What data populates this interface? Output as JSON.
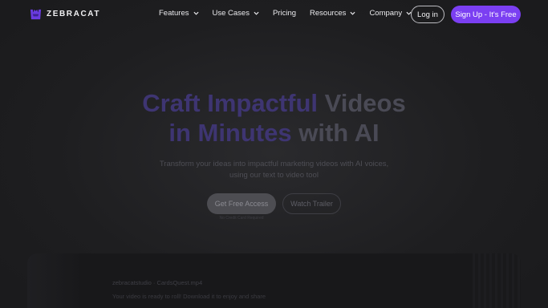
{
  "brand": {
    "name": "ZEBRACAT",
    "accent_color": "#7b3ff2"
  },
  "nav": {
    "items": [
      {
        "label": "Features",
        "dropdown": true
      },
      {
        "label": "Use Cases",
        "dropdown": true
      },
      {
        "label": "Pricing",
        "dropdown": false
      },
      {
        "label": "Resources",
        "dropdown": true
      },
      {
        "label": "Company",
        "dropdown": true
      }
    ],
    "login_label": "Log in",
    "signup_label": "Sign Up - It's Free"
  },
  "hero": {
    "title_line1_accent": "Craft Impactful",
    "title_line1_rest": " Videos",
    "title_line2_accent": "in Minutes",
    "title_line2_rest": " with AI",
    "subtitle_line1": "Transform your ideas into impactful marketing videos with AI voices,",
    "subtitle_line2": "using our text to video tool",
    "primary_cta": "Get Free Access",
    "secondary_cta": "Watch Trailer",
    "note": "No Credit Card Required"
  },
  "preview": {
    "file_label": "zebracatstudio  ·  CardsQuest.mp4",
    "message": "Your video is ready to roll! Download it to enjoy and share"
  }
}
